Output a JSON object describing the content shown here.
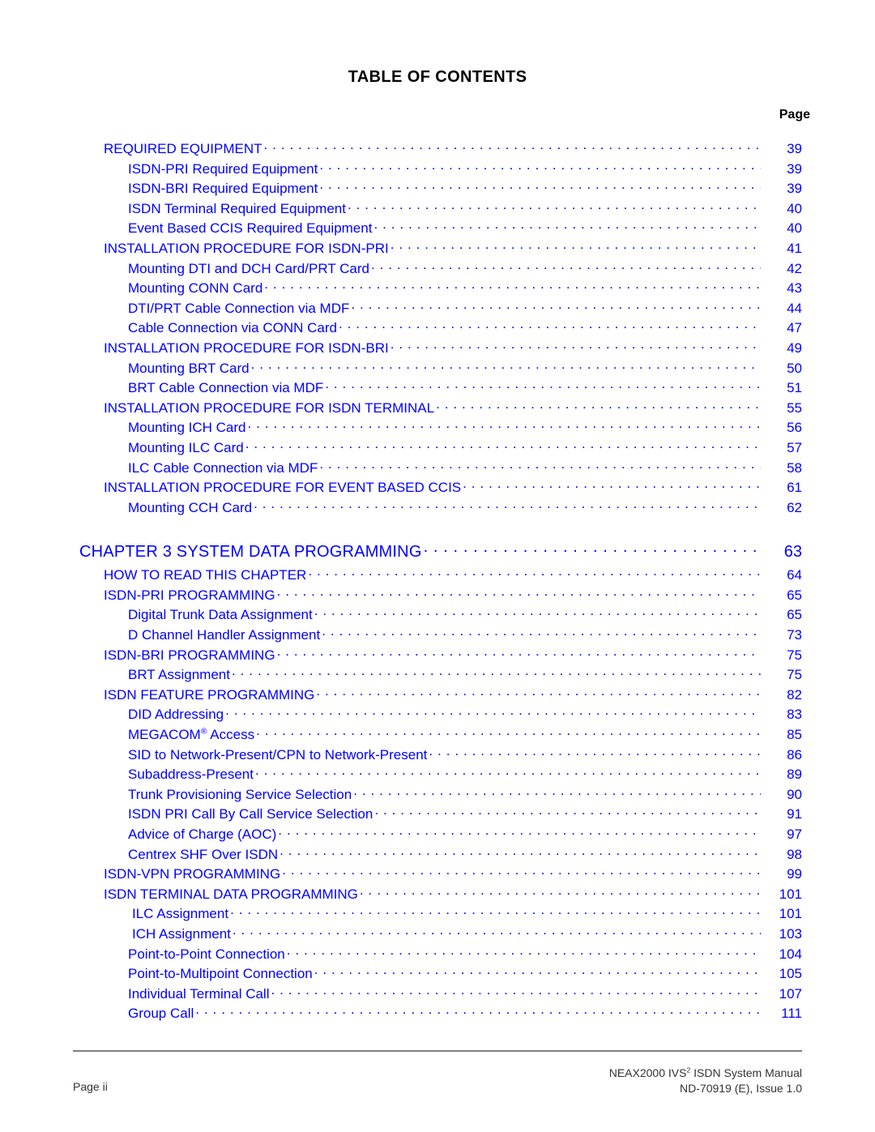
{
  "document": {
    "title": "TABLE OF CONTENTS",
    "page_column_header": "Page"
  },
  "toc": {
    "entries": [
      {
        "label": "REQUIRED EQUIPMENT",
        "page": "39",
        "level": 1
      },
      {
        "label": "ISDN-PRI Required Equipment",
        "page": "39",
        "level": 2
      },
      {
        "label": "ISDN-BRI Required Equipment",
        "page": "39",
        "level": 2
      },
      {
        "label": "ISDN Terminal Required Equipment",
        "page": "40",
        "level": 2
      },
      {
        "label": "Event Based CCIS Required Equipment",
        "page": "40",
        "level": 2
      },
      {
        "label": "INSTALLATION PROCEDURE FOR ISDN-PRI",
        "page": "41",
        "level": 1
      },
      {
        "label": "Mounting DTI and DCH Card/PRT Card",
        "page": "42",
        "level": 2
      },
      {
        "label": "Mounting CONN Card",
        "page": "43",
        "level": 2
      },
      {
        "label": "DTI/PRT Cable Connection via MDF",
        "page": "44",
        "level": 2
      },
      {
        "label": "Cable Connection via CONN Card",
        "page": "47",
        "level": 2
      },
      {
        "label": "INSTALLATION PROCEDURE FOR ISDN-BRI",
        "page": "49",
        "level": 1
      },
      {
        "label": "Mounting BRT Card",
        "page": "50",
        "level": 2
      },
      {
        "label": "BRT Cable Connection via MDF",
        "page": "51",
        "level": 2
      },
      {
        "label": "INSTALLATION PROCEDURE FOR ISDN TERMINAL",
        "page": "55",
        "level": 1
      },
      {
        "label": "Mounting ICH Card",
        "page": "56",
        "level": 2
      },
      {
        "label": "Mounting ILC Card",
        "page": "57",
        "level": 2
      },
      {
        "label": "ILC Cable Connection via MDF",
        "page": "58",
        "level": 2
      },
      {
        "label": "INSTALLATION PROCEDURE FOR EVENT BASED CCIS",
        "page": "61",
        "level": 1
      },
      {
        "label": "Mounting CCH Card",
        "page": "62",
        "level": 2
      },
      {
        "label": "CHAPTER 3    SYSTEM DATA PROGRAMMING",
        "page": "63",
        "level": 0
      },
      {
        "label": "HOW TO READ THIS CHAPTER",
        "page": "64",
        "level": 1
      },
      {
        "label": "ISDN-PRI PROGRAMMING",
        "page": "65",
        "level": 1
      },
      {
        "label": "Digital Trunk Data Assignment",
        "page": "65",
        "level": 2
      },
      {
        "label": "D Channel Handler Assignment",
        "page": "73",
        "level": 2
      },
      {
        "label": "ISDN-BRI PROGRAMMING",
        "page": "75",
        "level": 1
      },
      {
        "label": "BRT Assignment",
        "page": "75",
        "level": 2
      },
      {
        "label": "ISDN FEATURE PROGRAMMING",
        "page": "82",
        "level": 1
      },
      {
        "label": "DID Addressing",
        "page": "83",
        "level": 2
      },
      {
        "label": "MEGACOM® Access",
        "page": "85",
        "level": 2,
        "sup": "®",
        "label_pre": "MEGACOM",
        "label_post": " Access"
      },
      {
        "label": "SID to Network-Present/CPN to Network-Present",
        "page": "86",
        "level": 2
      },
      {
        "label": "Subaddress-Present",
        "page": "89",
        "level": 2
      },
      {
        "label": "Trunk Provisioning Service Selection",
        "page": "90",
        "level": 2
      },
      {
        "label": "ISDN PRI Call By Call Service Selection",
        "page": "91",
        "level": 2
      },
      {
        "label": "Advice of Charge (AOC)",
        "page": "97",
        "level": 2
      },
      {
        "label": "Centrex SHF Over ISDN",
        "page": "98",
        "level": 2
      },
      {
        "label": "ISDN-VPN PROGRAMMING",
        "page": "99",
        "level": 1
      },
      {
        "label": "ISDN TERMINAL DATA PROGRAMMING",
        "page": "101",
        "level": 1
      },
      {
        "label": "ILC Assignment",
        "page": "101",
        "level": 3
      },
      {
        "label": "ICH Assignment",
        "page": "103",
        "level": 3
      },
      {
        "label": "Point-to-Point Connection",
        "page": "104",
        "level": 2
      },
      {
        "label": "Point-to-Multipoint Connection",
        "page": "105",
        "level": 2
      },
      {
        "label": "Individual Terminal Call",
        "page": "107",
        "level": 2
      },
      {
        "label": "Group Call",
        "page": "111",
        "level": 2
      }
    ]
  },
  "footer": {
    "page_label": "Page ii",
    "manual_line1_pre": "NEAX2000 IVS",
    "manual_line1_sup": "2",
    "manual_line1_post": " ISDN System Manual",
    "manual_line2": "ND-70919 (E), Issue 1.0"
  },
  "colors": {
    "entry_text": "#0000FF",
    "title_text": "#000000",
    "footer_text": "#333333",
    "rule": "#808080"
  }
}
